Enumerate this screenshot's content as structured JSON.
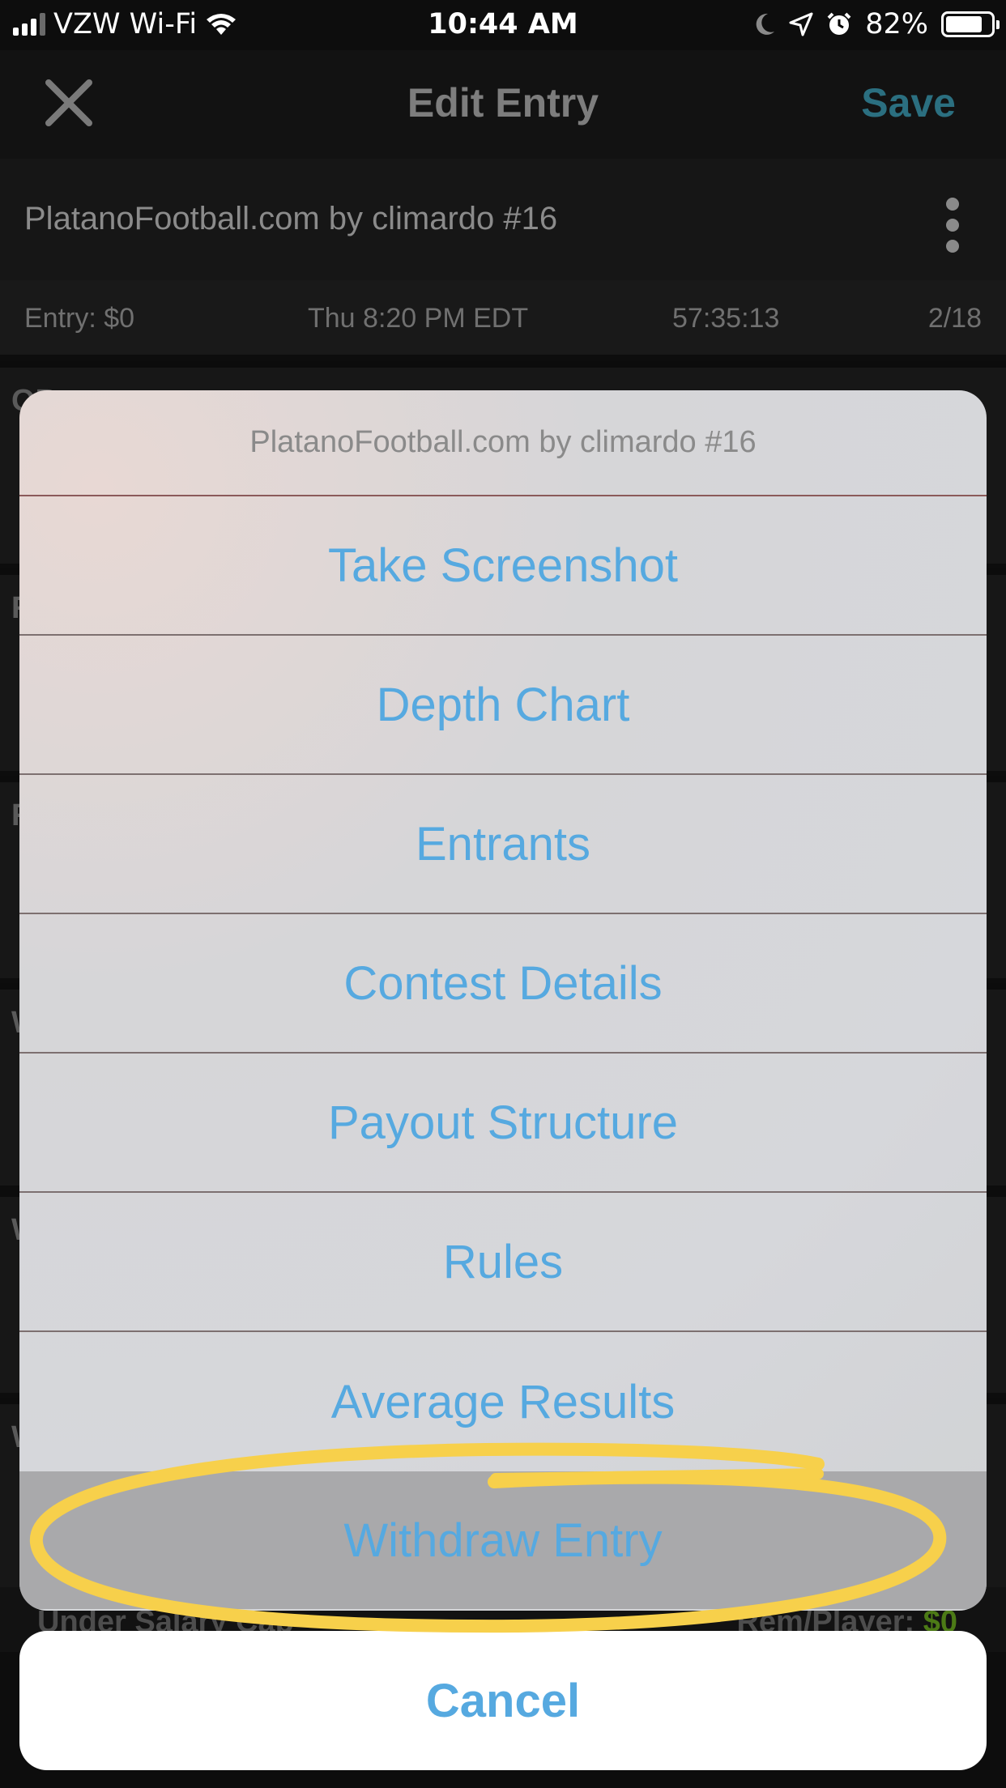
{
  "status_bar": {
    "carrier": "VZW Wi-Fi",
    "time": "10:44 AM",
    "battery": "82%",
    "battery_level": 0.82
  },
  "nav": {
    "title": "Edit Entry",
    "save_label": "Save",
    "close_icon": "close-icon"
  },
  "contest": {
    "name": "PlatanoFootball.com by climardo #16"
  },
  "info": {
    "entry": "Entry: $0",
    "start": "Thu 8:20 PM EDT",
    "countdown": "57:35:13",
    "entrants": "2/18"
  },
  "background_positions": [
    "QB",
    "R",
    "R",
    "W",
    "W",
    "W"
  ],
  "footer": {
    "salary": "Under Salary Cap",
    "rem_label": "Rem/Player:",
    "rem_value": "$0"
  },
  "action_sheet": {
    "title": "PlatanoFootball.com by climardo #16",
    "items": [
      "Take Screenshot",
      "Depth Chart",
      "Entrants",
      "Contest Details",
      "Payout Structure",
      "Rules",
      "Average Results",
      "Withdraw Entry"
    ],
    "cancel_label": "Cancel"
  },
  "colors": {
    "action_blue": "#56a9e0",
    "save_teal": "#2b6f80",
    "highlight_yellow": "#f7d04b",
    "rem_green": "#4c7a16"
  }
}
